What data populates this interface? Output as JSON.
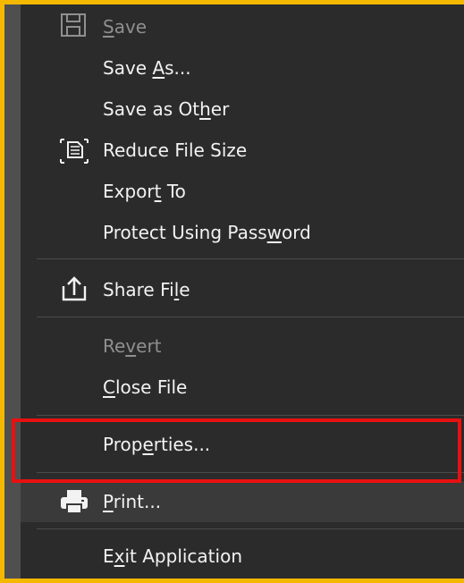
{
  "menu": {
    "items": [
      {
        "id": "save",
        "pre": "",
        "u": "S",
        "post": "ave",
        "disabled": true,
        "icon": "save-icon"
      },
      {
        "id": "save-as",
        "pre": "Save ",
        "u": "A",
        "post": "s...",
        "disabled": false,
        "icon": ""
      },
      {
        "id": "save-as-other",
        "pre": "Save as Ot",
        "u": "h",
        "post": "er",
        "disabled": false,
        "icon": ""
      },
      {
        "id": "reduce-file-size",
        "pre": "Reduce File Size",
        "u": "",
        "post": "",
        "disabled": false,
        "icon": "reduce-file-size-icon"
      },
      {
        "id": "export-to",
        "pre": "Expor",
        "u": "t",
        "post": " To",
        "disabled": false,
        "icon": ""
      },
      {
        "id": "protect-using-password",
        "pre": "Protect Using Pass",
        "u": "w",
        "post": "ord",
        "disabled": false,
        "icon": ""
      },
      {
        "id": "share-file",
        "pre": "Share Fi",
        "u": "l",
        "post": "e",
        "disabled": false,
        "icon": "share-icon"
      },
      {
        "id": "revert",
        "pre": "Re",
        "u": "v",
        "post": "ert",
        "disabled": true,
        "icon": ""
      },
      {
        "id": "close-file",
        "pre": "",
        "u": "C",
        "post": "lose File",
        "disabled": false,
        "icon": ""
      },
      {
        "id": "properties",
        "pre": "Prop",
        "u": "e",
        "post": "rties...",
        "disabled": false,
        "icon": ""
      },
      {
        "id": "print",
        "pre": "",
        "u": "P",
        "post": "rint...",
        "disabled": false,
        "icon": "printer-icon"
      },
      {
        "id": "exit-application",
        "pre": "E",
        "u": "x",
        "post": "it Application",
        "disabled": false,
        "icon": ""
      }
    ]
  },
  "colors": {
    "menu_bg": "#2b2b2b",
    "text": "#f2f2f2",
    "disabled_text": "#8f8f8f",
    "frame_border": "#f5b800",
    "highlight_border": "#e81010"
  }
}
